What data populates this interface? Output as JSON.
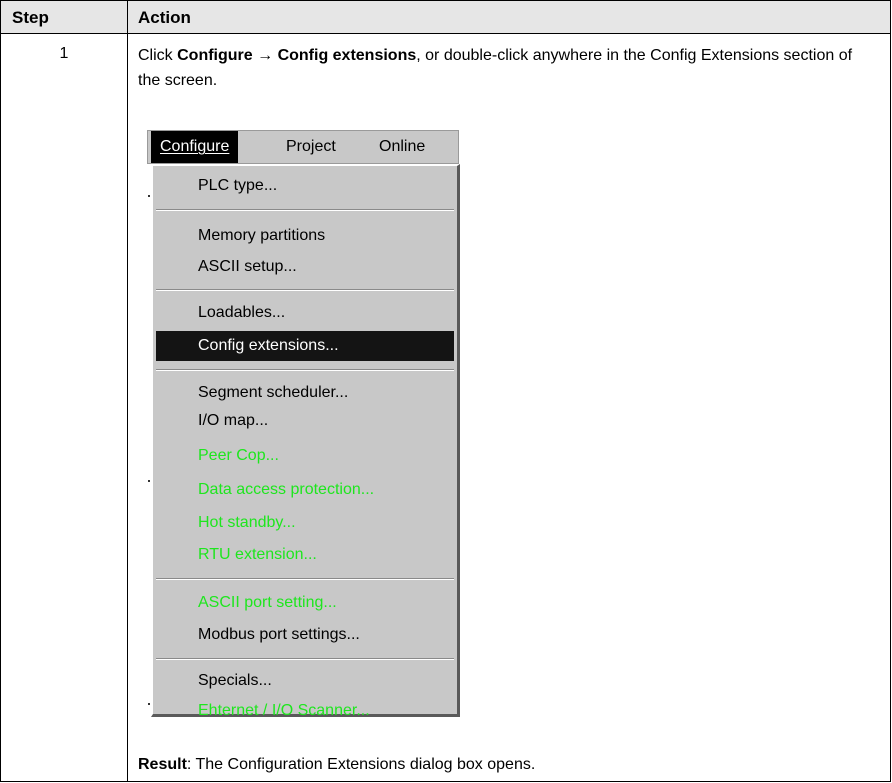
{
  "table": {
    "headers": {
      "step": "Step",
      "action": "Action"
    },
    "step_number": "1",
    "action": {
      "part1": "Click ",
      "bold1": "Configure",
      "arrow": "→",
      "bold2": "Config extensions",
      "part2": ", or double-click anywhere in the Config Extensions section of the screen."
    },
    "result": {
      "label": "Result",
      "text": ": The Configuration Extensions dialog box opens."
    }
  },
  "menubar": {
    "items": [
      {
        "label": "Configure",
        "active": true
      },
      {
        "label": "Project",
        "active": false
      },
      {
        "label": "Online",
        "active": false
      }
    ]
  },
  "menu": {
    "items": [
      {
        "label": "PLC type...",
        "state": "enabled"
      },
      {
        "label": "Memory partitions",
        "state": "enabled"
      },
      {
        "label": "ASCII setup...",
        "state": "enabled"
      },
      {
        "label": "Loadables...",
        "state": "enabled"
      },
      {
        "label": "Config extensions...",
        "state": "selected"
      },
      {
        "label": "Segment scheduler...",
        "state": "enabled"
      },
      {
        "label": "I/O map...",
        "state": "enabled"
      },
      {
        "label": "Peer Cop...",
        "state": "disabled"
      },
      {
        "label": "Data access protection...",
        "state": "disabled"
      },
      {
        "label": "Hot standby...",
        "state": "disabled"
      },
      {
        "label": "RTU extension...",
        "state": "disabled"
      },
      {
        "label": "ASCII port setting...",
        "state": "disabled"
      },
      {
        "label": "Modbus port settings...",
        "state": "enabled"
      },
      {
        "label": "Specials...",
        "state": "enabled"
      },
      {
        "label": "Ehternet / I/O Scanner...",
        "state": "disabled"
      }
    ]
  },
  "colors": {
    "disabled_text": "#1ee61e",
    "menu_bg": "#c8c8c8",
    "selected_bg": "#141414",
    "header_bg": "#e6e6e6"
  }
}
